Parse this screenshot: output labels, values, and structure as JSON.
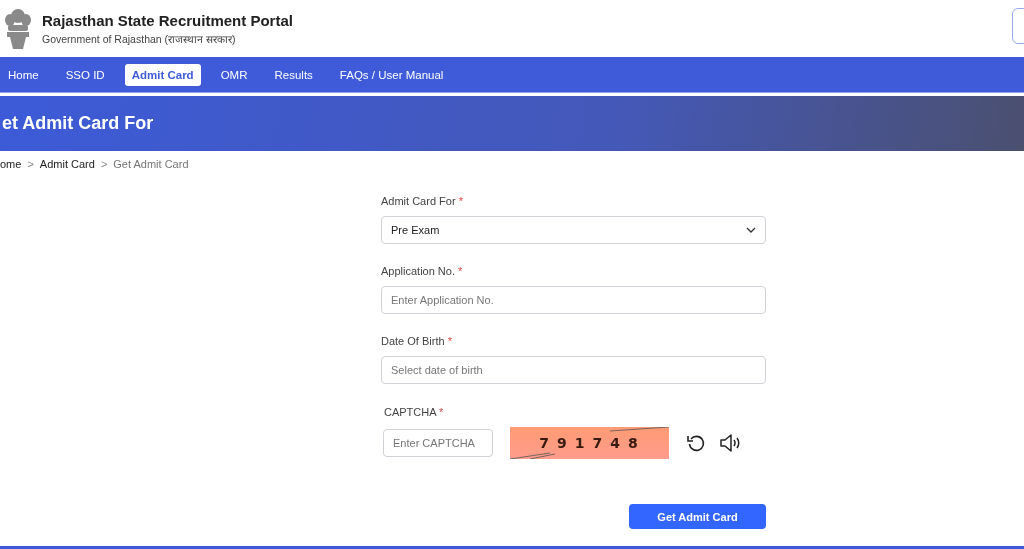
{
  "header": {
    "title": "Rajasthan State Recruitment Portal",
    "subtitle": "Government of Rajasthan (राजस्थान सरकार)"
  },
  "nav": [
    {
      "label": "Home",
      "selected": false
    },
    {
      "label": "SSO ID",
      "selected": false
    },
    {
      "label": "Admit Card",
      "selected": true
    },
    {
      "label": "OMR",
      "selected": false
    },
    {
      "label": "Results",
      "selected": false
    },
    {
      "label": "FAQs / User Manual",
      "selected": false
    }
  ],
  "banner": {
    "title": "et Admit Card For"
  },
  "breadcrumb": [
    {
      "label": "ome",
      "current": false
    },
    {
      "label": "Admit Card",
      "current": false
    },
    {
      "label": "Get Admit Card",
      "current": true
    }
  ],
  "breadcrumb_separator": ">",
  "form": {
    "fields": [
      {
        "kind": "select",
        "label": "Admit Card For",
        "required_mark": "*",
        "value": "Pre Exam"
      },
      {
        "kind": "text",
        "label": "Application No.",
        "required_mark": "*",
        "placeholder": "Enter Application No."
      },
      {
        "kind": "text",
        "label": "Date Of Birth",
        "required_mark": "*",
        "placeholder": "Select date of birth"
      }
    ],
    "captcha": {
      "label": "CAPTCHA",
      "required_mark": "*",
      "placeholder": "Enter CAPTCHA",
      "code": "791748"
    },
    "submit": "Get Admit Card"
  }
}
